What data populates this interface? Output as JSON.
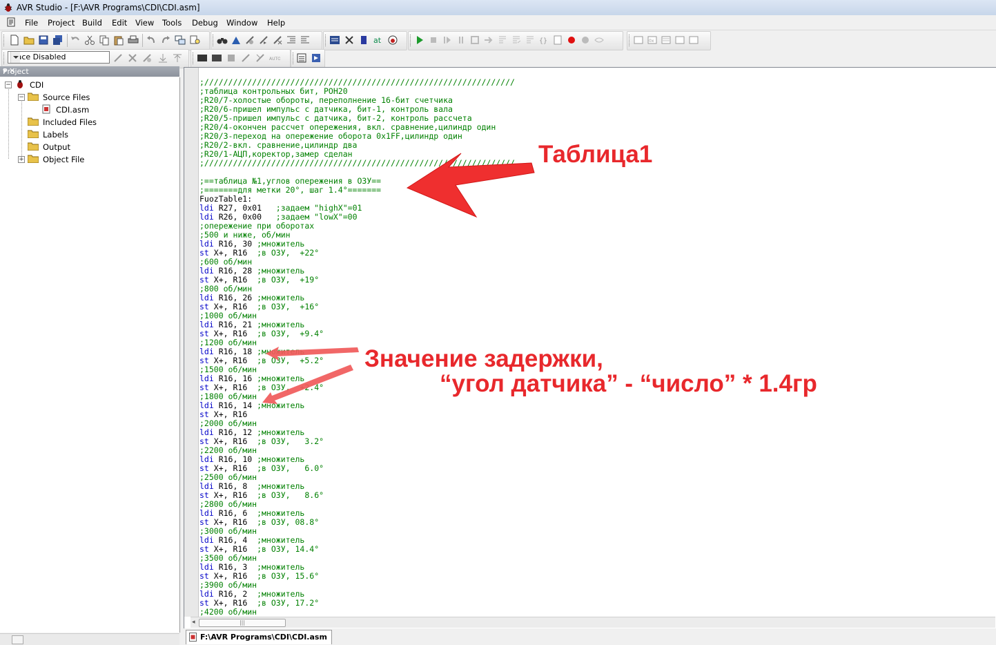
{
  "window": {
    "title": "AVR Studio - [F:\\AVR Programs\\CDI\\CDI.asm]"
  },
  "menu": [
    "File",
    "Project",
    "Build",
    "Edit",
    "View",
    "Tools",
    "Debug",
    "Window",
    "Help"
  ],
  "trace_combo": {
    "value": "Trace Disabled"
  },
  "project_panel": {
    "title": "Project",
    "tree": {
      "root": "CDI",
      "source_files": "Source Files",
      "file": "CDI.asm",
      "included_files": "Included Files",
      "labels": "Labels",
      "output": "Output",
      "object_file": "Object File"
    }
  },
  "editor": {
    "tab_label": "F:\\AVR Programs\\CDI\\CDI.asm",
    "lines": [
      {
        "t": ";/////////////////////////////////////////////////////////////////",
        "c": "c"
      },
      {
        "t": ";таблица контрольных бит, РОН20",
        "c": "c"
      },
      {
        "t": ";R20/7-холостые обороты, переполнение 16-бит счетчика",
        "c": "c"
      },
      {
        "t": ";R20/6-пришел импульс с датчика, бит-1, контроль вала",
        "c": "c"
      },
      {
        "t": ";R20/5-пришел импульс с датчика, бит-2, контроль рассчета",
        "c": "c"
      },
      {
        "t": ";R20/4-окончен рассчет опережения, вкл. сравнение,цилиндр один",
        "c": "c"
      },
      {
        "t": ";R20/3-переход на опережение оборота 0x1FF,цилиндр один",
        "c": "c"
      },
      {
        "t": ";R20/2-вкл. сравнение,цилиндр два",
        "c": "c"
      },
      {
        "t": ";R20/1-АЦП,коректор,замер сделан",
        "c": "c"
      },
      {
        "t": ";/////////////////////////////////////////////////////////////////",
        "c": "c"
      },
      {
        "t": "",
        "c": "c"
      },
      {
        "t": ";==таблица №1,углов опережения в ОЗУ==",
        "c": "c"
      },
      {
        "t": ";=======для метки 20°, шаг 1.4°=======",
        "c": "c"
      },
      {
        "t": "FuozTable1:",
        "c": "n"
      },
      {
        "k": "ldi",
        "t": " R27, 0x01   ",
        "r": ";задаем \"highX\"=01"
      },
      {
        "k": "ldi",
        "t": " R26, 0x00   ",
        "r": ";задаем \"lowX\"=00"
      },
      {
        "t": ";опережение при оборотах",
        "c": "c"
      },
      {
        "t": ";500 и ниже, об/мин",
        "c": "c"
      },
      {
        "k": "ldi",
        "t": " R16, 30 ",
        "r": ";множитель"
      },
      {
        "k": "st",
        "t": " X+, R16  ",
        "r": ";в ОЗУ,  +22°"
      },
      {
        "t": ";600 об/мин",
        "c": "c"
      },
      {
        "k": "ldi",
        "t": " R16, 28 ",
        "r": ";множитель"
      },
      {
        "k": "st",
        "t": " X+, R16  ",
        "r": ";в ОЗУ,  +19°"
      },
      {
        "t": ";800 об/мин",
        "c": "c"
      },
      {
        "k": "ldi",
        "t": " R16, 26 ",
        "r": ";множитель"
      },
      {
        "k": "st",
        "t": " X+, R16  ",
        "r": ";в ОЗУ,  +16°"
      },
      {
        "t": ";1000 об/мин",
        "c": "c"
      },
      {
        "k": "ldi",
        "t": " R16, 21 ",
        "r": ";множитель"
      },
      {
        "k": "st",
        "t": " X+, R16  ",
        "r": ";в ОЗУ,  +9.4°"
      },
      {
        "t": ";1200 об/мин",
        "c": "c"
      },
      {
        "k": "ldi",
        "t": " R16, 18 ",
        "r": ";множитель"
      },
      {
        "k": "st",
        "t": " X+, R16  ",
        "r": ";в ОЗУ,  +5.2°"
      },
      {
        "t": ";1500 об/мин",
        "c": "c"
      },
      {
        "k": "ldi",
        "t": " R16, 16 ",
        "r": ";множитель"
      },
      {
        "k": "st",
        "t": " X+, R16  ",
        "r": ";в ОЗУ,  +2.4°"
      },
      {
        "t": ";1800 об/мин",
        "c": "c"
      },
      {
        "k": "ldi",
        "t": " R16, 14 ",
        "r": ";множитель"
      },
      {
        "k": "st",
        "t": " X+, R16  ",
        "r": ""
      },
      {
        "t": ";2000 об/мин",
        "c": "c"
      },
      {
        "k": "ldi",
        "t": " R16, 12 ",
        "r": ";множитель"
      },
      {
        "k": "st",
        "t": " X+, R16  ",
        "r": ";в ОЗУ,   3.2°"
      },
      {
        "t": ";2200 об/мин",
        "c": "c"
      },
      {
        "k": "ldi",
        "t": " R16, 10 ",
        "r": ";множитель"
      },
      {
        "k": "st",
        "t": " X+, R16  ",
        "r": ";в ОЗУ,   6.0°"
      },
      {
        "t": ";2500 об/мин",
        "c": "c"
      },
      {
        "k": "ldi",
        "t": " R16, 8  ",
        "r": ";множитель"
      },
      {
        "k": "st",
        "t": " X+, R16  ",
        "r": ";в ОЗУ,   8.6°"
      },
      {
        "t": ";2800 об/мин",
        "c": "c"
      },
      {
        "k": "ldi",
        "t": " R16, 6  ",
        "r": ";множитель"
      },
      {
        "k": "st",
        "t": " X+, R16  ",
        "r": ";в ОЗУ, 08.8°"
      },
      {
        "t": ";3000 об/мин",
        "c": "c"
      },
      {
        "k": "ldi",
        "t": " R16, 4  ",
        "r": ";множитель"
      },
      {
        "k": "st",
        "t": " X+, R16  ",
        "r": ";в ОЗУ, 14.4°"
      },
      {
        "t": ";3500 об/мин",
        "c": "c"
      },
      {
        "k": "ldi",
        "t": " R16, 3  ",
        "r": ";множитель"
      },
      {
        "k": "st",
        "t": " X+, R16  ",
        "r": ";в ОЗУ, 15.6°"
      },
      {
        "t": ";3900 об/мин",
        "c": "c"
      },
      {
        "k": "ldi",
        "t": " R16, 2  ",
        "r": ";множитель"
      },
      {
        "k": "st",
        "t": " X+, R16  ",
        "r": ";в ОЗУ, 17.2°"
      },
      {
        "t": ";4200 об/мин",
        "c": "c"
      }
    ]
  },
  "annotations": {
    "label1": "Таблица1",
    "label2_line1": "Значение задержки,",
    "label2_line2": "“угол датчика” - “число” * 1.4гр",
    "color": "#e8282c"
  },
  "colors": {
    "keyword": "#0000c8",
    "comment": "#008000"
  }
}
